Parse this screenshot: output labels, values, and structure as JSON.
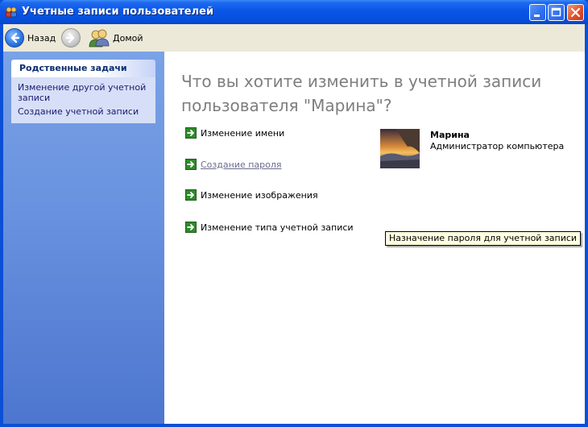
{
  "window": {
    "title": "Учетные записи пользователей",
    "title_icon": "users-icon"
  },
  "toolbar": {
    "back_label": "Назад",
    "home_label": "Домой"
  },
  "tasks": {
    "header": "Родственные задачи",
    "links": [
      "Изменение другой учетной записи",
      "Создание учетной записи"
    ]
  },
  "main": {
    "question": "Что вы хотите изменить в учетной записи пользователя \"Марина\"?",
    "actions": [
      "Изменение имени",
      "Создание пароля",
      "Изменение изображения",
      "Изменение типа учетной записи"
    ],
    "tooltip": "Назначение пароля для учетной записи"
  },
  "user": {
    "name": "Марина",
    "role": "Администратор компьютера"
  },
  "colors": {
    "title_bar": "#0a55e6",
    "sidebar": "#6a93e0",
    "question_text": "#7e7e7e",
    "action_arrow": "#2f8a2b",
    "tooltip_bg": "#ffffe1"
  }
}
